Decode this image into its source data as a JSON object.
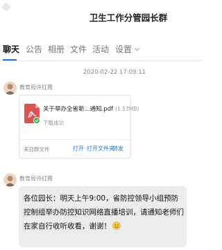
{
  "window": {
    "title": "卫生工作分管园长群"
  },
  "tabs": [
    {
      "label": "聊天"
    },
    {
      "label": "公告"
    },
    {
      "label": "相册"
    },
    {
      "label": "文件"
    },
    {
      "label": "活动"
    },
    {
      "label": "设置"
    }
  ],
  "chat": {
    "timestamp": "2020-02-22 17:09:11",
    "messages": [
      {
        "sender": "教育局许红霞",
        "file": {
          "name": "关于举办全省新...通知.pdf",
          "size": "(1.57MB)",
          "status": "下载成功",
          "source": "来自群文件",
          "actions": [
            "打开",
            "打开文件夹",
            "转发"
          ]
        }
      },
      {
        "sender": "教育局许红霞",
        "text": "各位园长：明天上午9:00，省防控领导小组预防控制组举办防控知识网络直播培训，请通知老师们在家自行收听收看，谢谢！"
      }
    ]
  },
  "colors": {
    "accent": "#1a73e8",
    "link": "#2a7ad6",
    "bubble": "#ececec",
    "pdf": "#d9534f",
    "success": "#3bb54a"
  }
}
